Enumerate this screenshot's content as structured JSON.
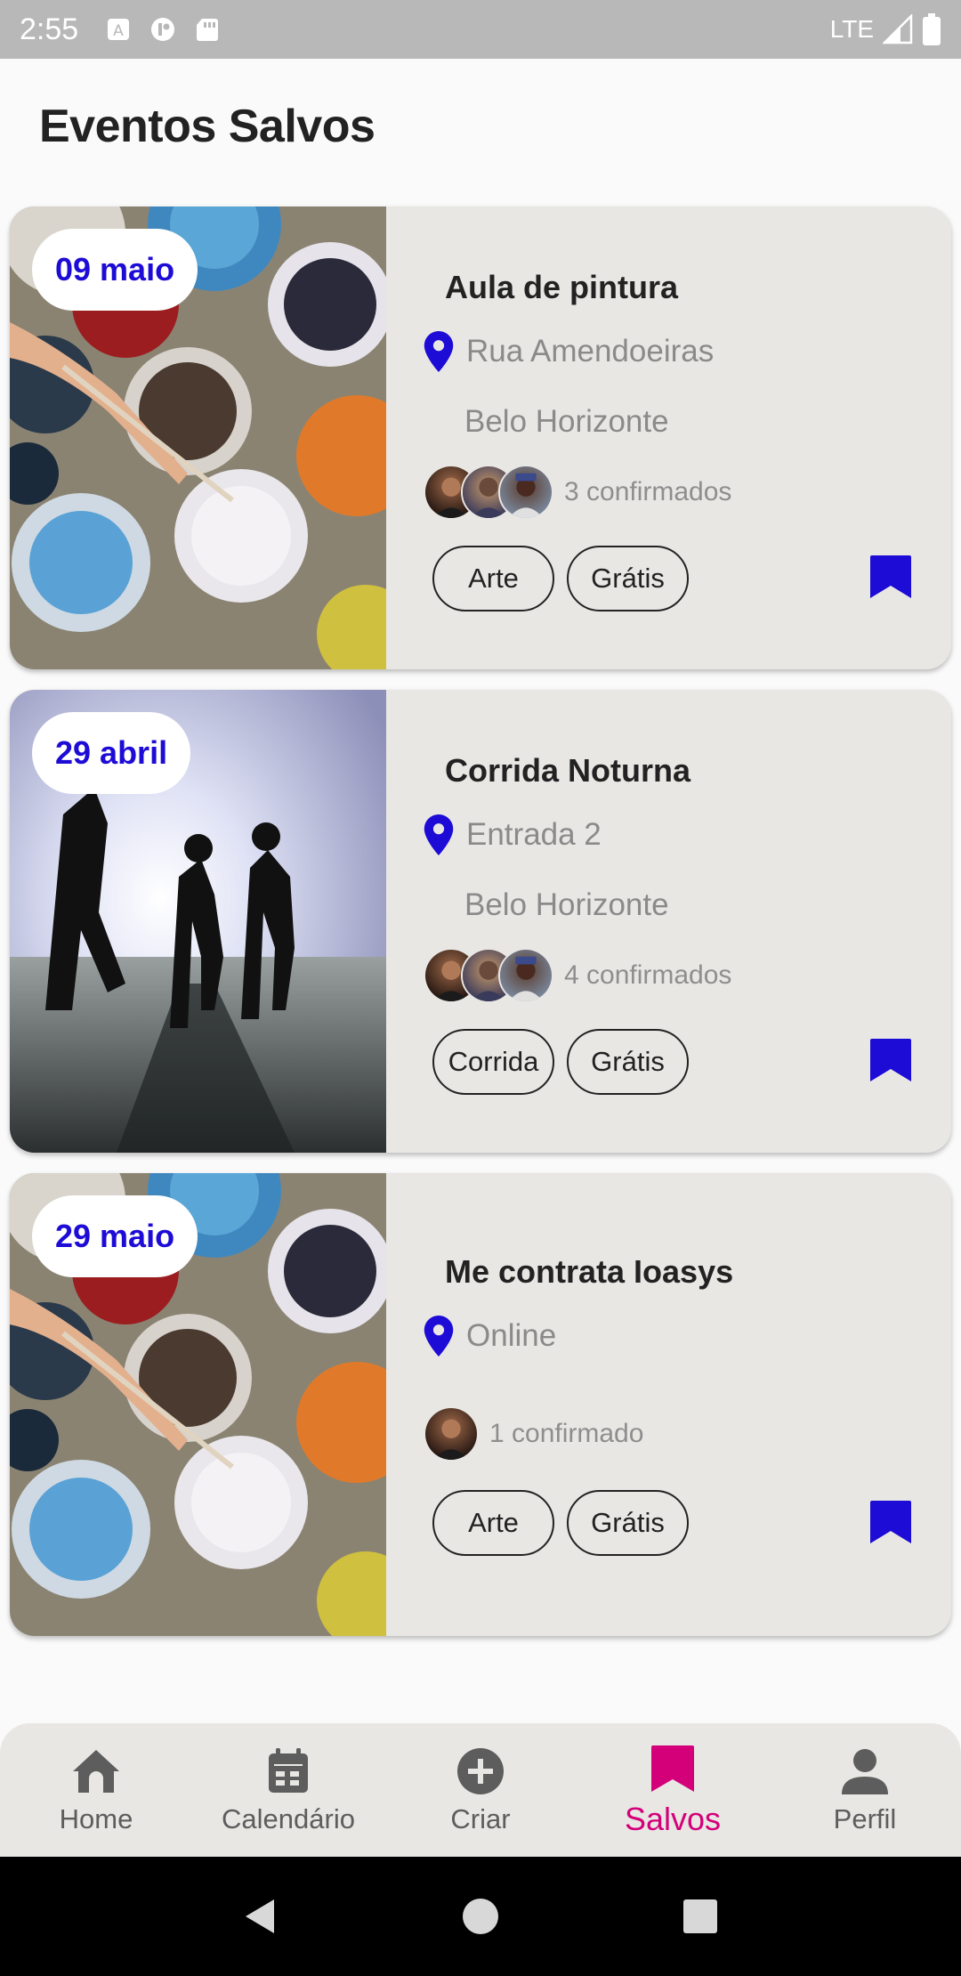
{
  "status_bar": {
    "time": "2:55",
    "network": "LTE",
    "icons": [
      "a-notification-icon",
      "app-notification-icon",
      "sd-card-icon",
      "signal-icon",
      "battery-icon"
    ]
  },
  "page": {
    "title": "Eventos Salvos"
  },
  "colors": {
    "accent_blue": "#1d0bd6",
    "active_pink": "#d4007a",
    "card_bg": "#e9e7e4"
  },
  "events": [
    {
      "date": "09 maio",
      "title": "Aula de pintura",
      "location_line1": "Rua Amendoeiras",
      "location_line2": "Belo Horizonte",
      "attendees": "3 confirmados",
      "tags": [
        "Arte",
        "Grátis"
      ],
      "image": "paint-buckets"
    },
    {
      "date": "29 abril",
      "title": "Corrida Noturna",
      "location_line1": "Entrada 2",
      "location_line2": "Belo Horizonte",
      "attendees": "4 confirmados",
      "tags": [
        "Corrida",
        "Grátis"
      ],
      "image": "runners"
    },
    {
      "date": "29 maio",
      "title": "Me contrata Ioasys",
      "location_line1": "Online",
      "location_line2": "",
      "attendees": "1 confirmado",
      "tags": [
        "Arte",
        "Grátis"
      ],
      "image": "paint-buckets"
    }
  ],
  "bottom_nav": {
    "items": [
      {
        "label": "Home",
        "icon": "home-icon"
      },
      {
        "label": "Calendário",
        "icon": "calendar-icon"
      },
      {
        "label": "Criar",
        "icon": "add-circle-icon"
      },
      {
        "label": "Salvos",
        "icon": "bookmark-icon",
        "active": true
      },
      {
        "label": "Perfil",
        "icon": "person-icon"
      }
    ]
  }
}
